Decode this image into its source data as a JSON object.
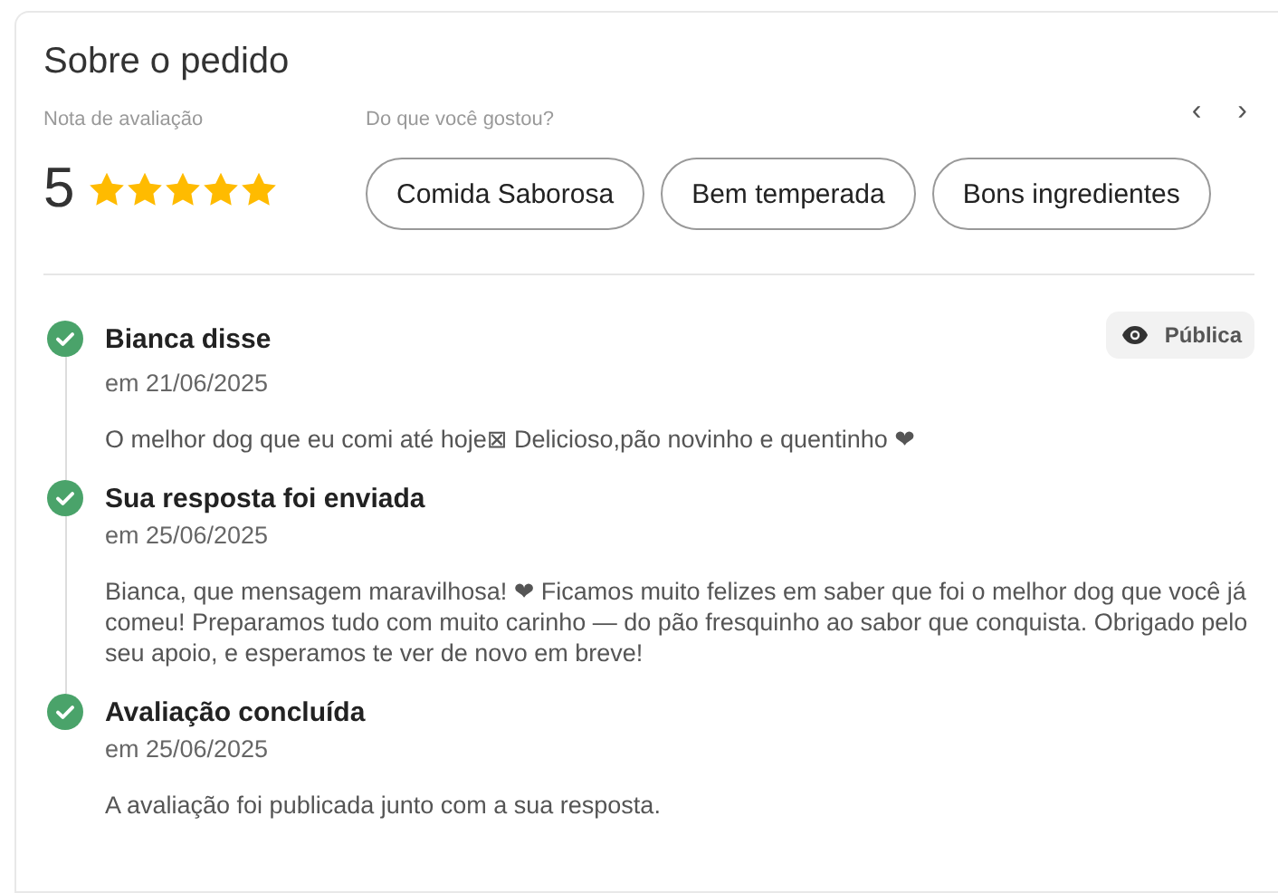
{
  "title": "Sobre o pedido",
  "rating": {
    "label": "Nota de avaliação",
    "value": "5",
    "stars": 5
  },
  "likes": {
    "label": "Do que você gostou?",
    "prev": "‹",
    "next": "›",
    "chips": [
      "Comida Saborosa",
      "Bem temperada",
      "Bons ingredientes"
    ]
  },
  "timeline": [
    {
      "title": "Bianca disse",
      "date": "em 21/06/2025",
      "text": "O melhor dog que eu comi até hoje⊠ Delicioso,pão novinho e quentinho ❤",
      "badge": "Pública"
    },
    {
      "title": "Sua resposta foi enviada",
      "date": "em 25/06/2025",
      "text": "Bianca, que mensagem maravilhosa! ❤ Ficamos muito felizes em saber que foi o melhor dog que você já comeu! Preparamos tudo com muito carinho — do pão fresquinho ao sabor que conquista. Obrigado pelo seu apoio, e esperamos te ver de novo em breve!"
    },
    {
      "title": "Avaliação concluída",
      "date": "em 25/06/2025",
      "text": "A avaliação foi publicada junto com a sua resposta."
    }
  ]
}
